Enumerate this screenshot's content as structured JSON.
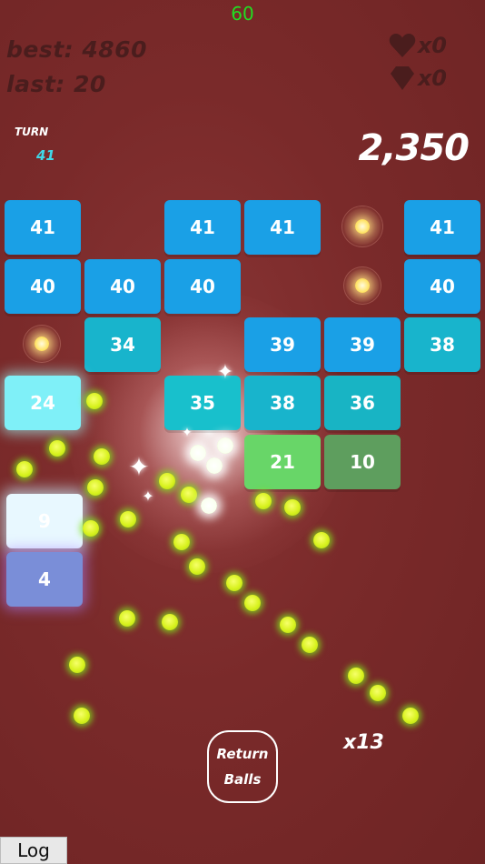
{
  "fps": "60",
  "stats": {
    "best": "best: 4860",
    "last": "last: 20"
  },
  "inventory": {
    "hearts": "x0",
    "gems": "x0",
    "heart_icon": "heart-icon",
    "gem_icon": "diamond-icon"
  },
  "turn": {
    "label": "TURN",
    "value": "41"
  },
  "score": "2,350",
  "bricks": [
    {
      "value": "41",
      "color": "#1aa0e6"
    },
    {
      "value": "41",
      "color": "#1aa0e6"
    },
    {
      "value": "41",
      "color": "#1aa0e6"
    },
    {
      "value": "41",
      "color": "#1aa0e6"
    },
    {
      "value": "40",
      "color": "#1aa0e6"
    },
    {
      "value": "40",
      "color": "#1aa0e6"
    },
    {
      "value": "40",
      "color": "#1aa0e6"
    },
    {
      "value": "40",
      "color": "#1aa0e6"
    },
    {
      "value": "34",
      "color": "#18b4cc"
    },
    {
      "value": "39",
      "color": "#1aa0e6"
    },
    {
      "value": "39",
      "color": "#1aa0e6"
    },
    {
      "value": "38",
      "color": "#18b4cc"
    },
    {
      "value": "24",
      "color": "#7ff0f8"
    },
    {
      "value": "35",
      "color": "#18c0cc"
    },
    {
      "value": "38",
      "color": "#18b4cc"
    },
    {
      "value": "36",
      "color": "#18b4c4"
    },
    {
      "value": "21",
      "color": "#68d668"
    },
    {
      "value": "10",
      "color": "#5e9e5e"
    },
    {
      "value": "9",
      "color": "#e8f8ff"
    },
    {
      "value": "4",
      "color": "#7a8ed8"
    }
  ],
  "extra_ball_pickups": 3,
  "balls_on_screen": 29,
  "colors": {
    "background": "#7a2a2a",
    "hud_text": "#4a1d1d",
    "turn_value": "#40d8e8",
    "ball": "#d8f21e"
  },
  "return_button": {
    "line1": "Return",
    "line2": "Balls"
  },
  "ball_multiplier": "x13",
  "log_button": "Log"
}
